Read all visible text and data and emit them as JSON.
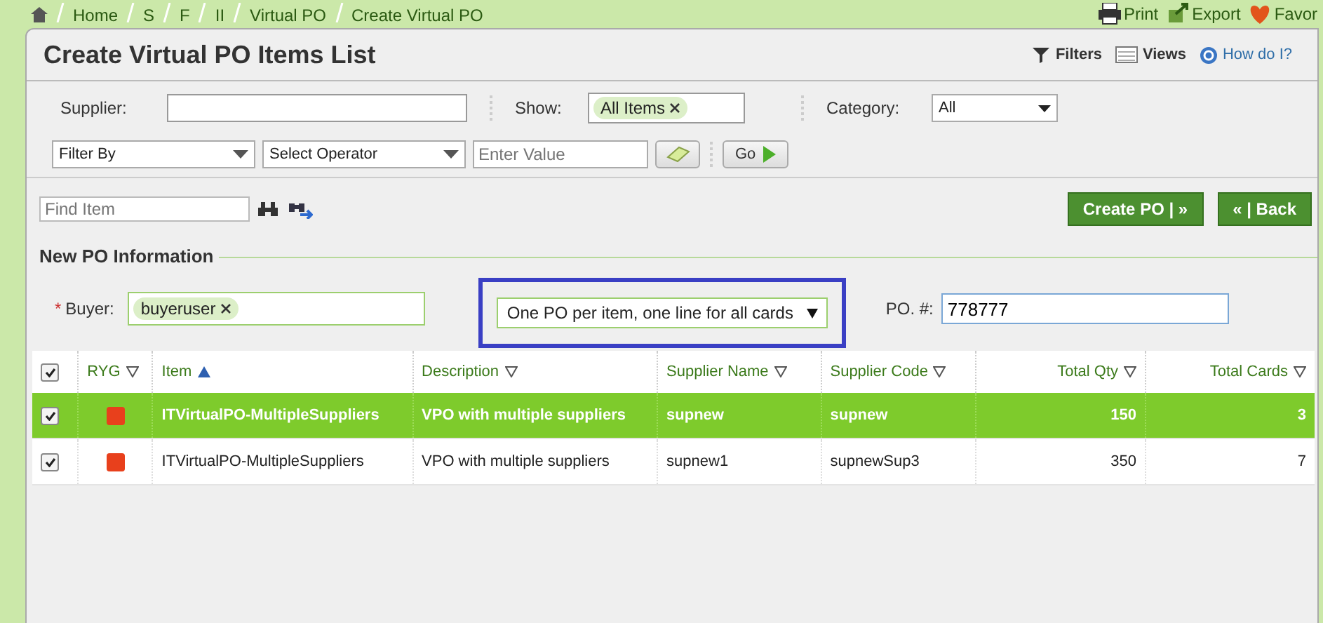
{
  "breadcrumbs": [
    "Home",
    "S",
    "F",
    "II",
    "Virtual PO",
    "Create Virtual PO"
  ],
  "top_actions": [
    "Print",
    "Export",
    "Favor"
  ],
  "title": "Create Virtual PO Items List",
  "header_actions": [
    "Filters",
    "Views",
    "How do I?"
  ],
  "filters": {
    "supplier_label": "Supplier:",
    "show_label": "Show:",
    "show_tag": "All Items",
    "category_label": "Category:",
    "category_value": "All",
    "filter_by": "Filter By",
    "operator": "Select Operator",
    "value_placeholder": "Enter Value",
    "go": "Go"
  },
  "find": {
    "placeholder": "Find Item"
  },
  "buttons": [
    "Create PO | »",
    "« | Back"
  ],
  "new_po": {
    "heading": "New PO Information",
    "required_mark": "*",
    "buyer_label": "Buyer:",
    "buyer_tag": "buyeruser",
    "mode": "One PO per item, one line for all cards",
    "po_label": "PO. #:",
    "po_value": "778777"
  },
  "table": {
    "all_checked": true,
    "columns": [
      {
        "label": "RYG",
        "sorted": false
      },
      {
        "label": "Item",
        "sorted": true
      },
      {
        "label": "Description",
        "sorted": false
      },
      {
        "label": "Supplier Name",
        "sorted": false
      },
      {
        "label": "Supplier Code",
        "sorted": false
      },
      {
        "label": "Total Qty",
        "sorted": false
      },
      {
        "label": "Total Cards",
        "sorted": false
      }
    ],
    "rows": [
      {
        "selected": true,
        "checked": true,
        "color": "#e8401c",
        "cells": [
          "",
          "ITVirtualPO-MultipleSuppliers",
          "VPO with multiple suppliers",
          "supnew",
          "supnew",
          "150",
          "3"
        ]
      },
      {
        "selected": false,
        "checked": true,
        "color": "#e8401c",
        "cells": [
          "",
          "ITVirtualPO-MultipleSuppliers",
          "VPO with multiple suppliers",
          "supnew1",
          "supnewSup3",
          "350",
          "7"
        ]
      }
    ]
  }
}
